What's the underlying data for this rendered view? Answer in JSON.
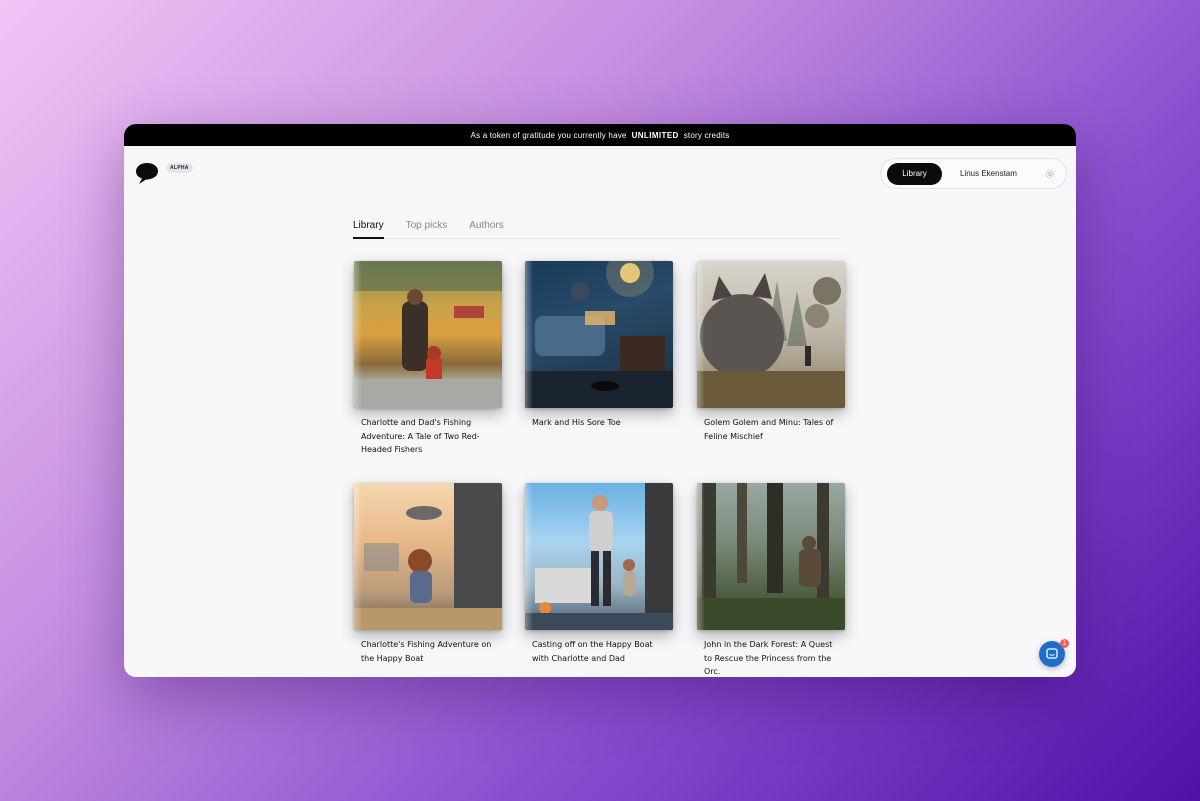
{
  "banner": {
    "prefix": "As a token of gratitude you currently have",
    "highlight": "UNLIMITED",
    "suffix": "story credits"
  },
  "header": {
    "badge": "ALPHA",
    "logo_icon": "speech-bubble-icon"
  },
  "nav": {
    "library_label": "Library",
    "user_name": "Linus Ekenstam",
    "settings_icon": "gear-icon"
  },
  "tabs": [
    {
      "label": "Library",
      "active": true
    },
    {
      "label": "Top picks",
      "active": false
    },
    {
      "label": "Authors",
      "active": false
    }
  ],
  "books": [
    {
      "title": "Charlotte and Dad's Fishing Adventure: A Tale of Two Red-Headed Fishers"
    },
    {
      "title": "Mark and His Sore Toe"
    },
    {
      "title": "Golem Golem and Minu: Tales of Feline Mischief"
    },
    {
      "title": "Charlotte's Fishing Adventure on the Happy Boat"
    },
    {
      "title": "Casting off on the Happy Boat with Charlotte and Dad"
    },
    {
      "title": "John in the Dark Forest: A Quest to Rescue the Princess from the Orc."
    }
  ],
  "chat": {
    "badge_count": "1",
    "icon": "chat-icon"
  }
}
